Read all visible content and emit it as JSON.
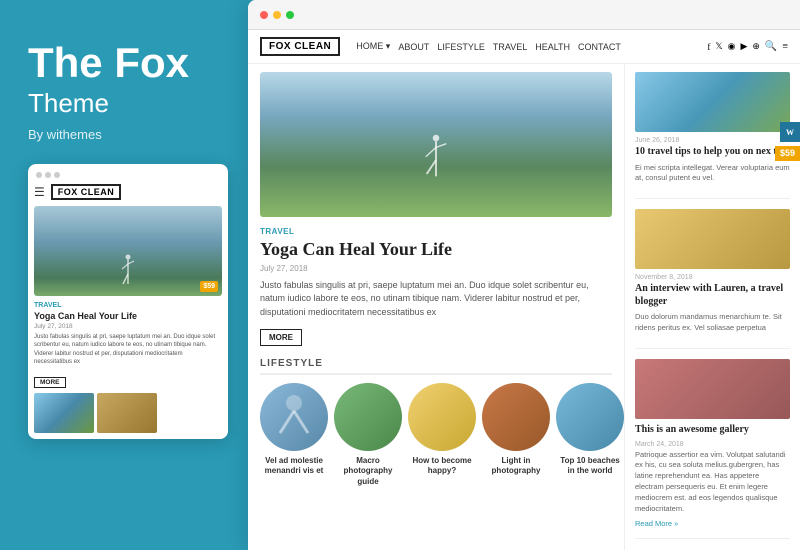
{
  "left": {
    "title": "The Fox",
    "subtitle": "Theme",
    "by": "By withemes"
  },
  "mobile": {
    "logo": "FOX CLEAN",
    "post_tag": "TRAVEL",
    "post_title": "Yoga Can Heal Your Life",
    "post_date": "July 27, 2018",
    "post_text": "Justo fabulas singulis at pri, saepe luptatum mei an. Duo idque solet scribentur eu, natum iudico labore te eos, no utinam tibique nam. Viderer labitur nostrud et per, disputationi mediocritatem necessitatibus ex",
    "more": "MORE",
    "price": "$59"
  },
  "browser": {
    "logo": "FOX CLEAN",
    "nav": {
      "links": [
        "HOME",
        "ABOUT",
        "LIFESTYLE",
        "TRAVEL",
        "HEALTH",
        "CONTACT"
      ]
    },
    "hero_post": {
      "tag": "TRAVEL",
      "title": "Yoga Can Heal Your Life",
      "date": "July 27, 2018",
      "excerpt": "Justo fabulas singulis at pri, saepe luptatum mei an. Duo idque solet scribentur eu, natum iudico labore te eos, no utinam tibique nam. Viderer labitur nostrud et per, disputationi mediocritatem necessitatibus ex",
      "more": "MORE"
    },
    "lifestyle_section": {
      "label": "LIFESTYLE",
      "items": [
        {
          "caption": "Vel ad molestie menandri vis et"
        },
        {
          "caption": "Macro photography guide"
        },
        {
          "caption": "How to become happy?"
        },
        {
          "caption": "Light in photography"
        },
        {
          "caption": "Top 10 beaches in the world"
        }
      ]
    },
    "right_posts": [
      {
        "date": "June 26, 2018",
        "title": "10 travel tips to help you on nex trip",
        "excerpt": "Ei mei scripta intellegat. Verear voluptaria eum at, consul putent eu vel."
      },
      {
        "date": "November 8, 2018",
        "title": "An interview with Lauren, a travel blogger",
        "excerpt": "Duo dolorum mandamus menarchium te. Sit ridens peritus ex. Vel soliasae perpetua"
      },
      {
        "date": "March 24, 2018",
        "title": "This is an awesome gallery",
        "excerpt": "Patrioque assertior ea vim. Volutpat salutandi ex his, cu sea soluta melius.gubergren, has latine reprehendunt ea. Has appetere electram persequeris eu. Et enim legere mediocrem est. ad eos legendos qualisque mediocritatem.",
        "read_more": "Read More »"
      }
    ],
    "price": "$59",
    "wp": "W"
  }
}
